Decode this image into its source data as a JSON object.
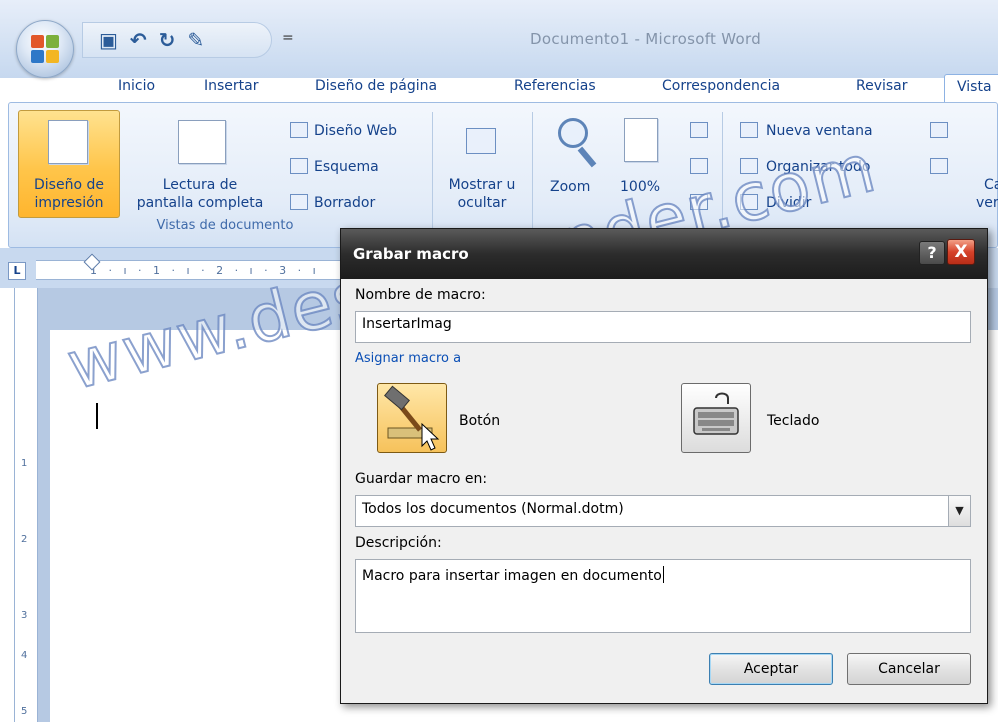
{
  "window": {
    "title": "Documento1 - Microsoft Word"
  },
  "quick_access": {
    "icons": [
      "save-icon",
      "undo-icon",
      "redo-icon",
      "format-painter-icon"
    ],
    "glyphs": [
      "▣",
      "↶",
      "↻",
      "✎"
    ],
    "more": "="
  },
  "ribbon": {
    "tabs": [
      "Inicio",
      "Insertar",
      "Diseño de página",
      "Referencias",
      "Correspondencia",
      "Revisar",
      "Vista"
    ],
    "active_tab": "Vista",
    "views": {
      "print_layout": [
        "Diseño de",
        "impresión"
      ],
      "full_screen": [
        "Lectura de",
        "pantalla completa"
      ],
      "web_layout": "Diseño Web",
      "outline": "Esquema",
      "draft": "Borrador",
      "group_label": "Vistas de documento"
    },
    "show_hide": [
      "Mostrar u",
      "ocultar"
    ],
    "zoom": "Zoom",
    "zoom_100": "100%",
    "window_group": {
      "new_window": "Nueva ventana",
      "arrange_all": "Organizar todo",
      "split": "Dividir"
    },
    "cut_off": [
      "Ca",
      "ver"
    ]
  },
  "ruler": {
    "corner": "L",
    "h_marks": "1 · ı · 1 · ı · 2 · ı · 3 · ı",
    "v_marks": [
      "1",
      "2",
      "3",
      "4",
      "5"
    ]
  },
  "watermark": "www.desoaprender.com",
  "dialog": {
    "title": "Grabar macro",
    "help": "?",
    "close": "X",
    "macro_name_label": "Nombre de macro:",
    "macro_name_value": "InsertarImag",
    "assign_label": "Asignar macro a",
    "button_label": "Botón",
    "keyboard_label": "Teclado",
    "store_label": "Guardar macro en:",
    "store_value": "Todos los documentos (Normal.dotm)",
    "description_label": "Descripción:",
    "description_value": "Macro para insertar imagen en documento",
    "ok": "Aceptar",
    "cancel": "Cancelar"
  },
  "colors": {
    "ribbon_text": "#15428b",
    "active_button": "#ffc54a",
    "dialog_titlebar": "#2c2c2c",
    "close_button": "#d6422a"
  }
}
